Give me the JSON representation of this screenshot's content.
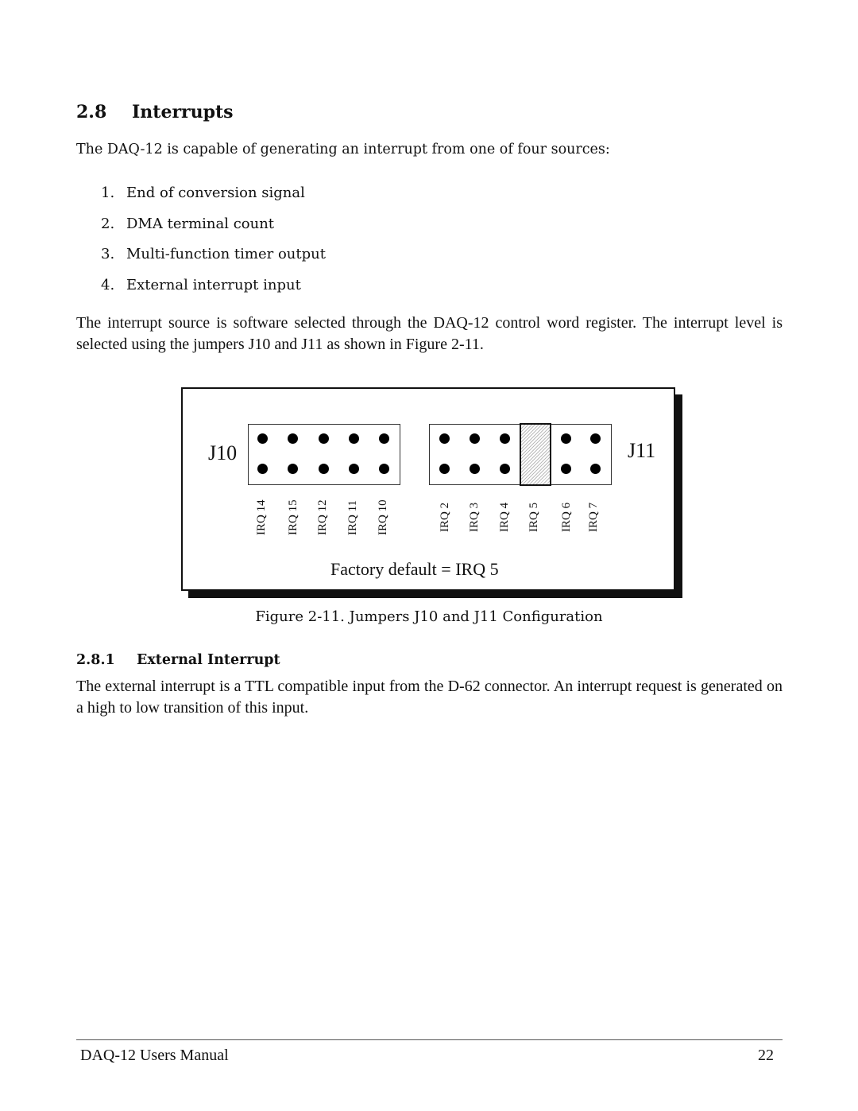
{
  "section": {
    "number": "2.8",
    "title": "Interrupts"
  },
  "intro": "The DAQ-12 is capable of generating an interrupt from one of four sources:",
  "sources": [
    {
      "num": "1.",
      "text": "End of conversion signal"
    },
    {
      "num": "2.",
      "text": "DMA terminal count"
    },
    {
      "num": "3.",
      "text": "Multi-function timer output"
    },
    {
      "num": "4.",
      "text": "External interrupt input"
    }
  ],
  "selection_paragraph": "The interrupt source is software selected through the DAQ-12 control word register. The interrupt level is selected using the jumpers J10 and J11 as shown in Figure 2-11.",
  "figure": {
    "j10_label": "J10",
    "j11_label": "J11",
    "j10_irqs": [
      "IRQ 14",
      "IRQ 15",
      "IRQ 12",
      "IRQ 11",
      "IRQ 10"
    ],
    "j11_irqs": [
      "IRQ 2",
      "IRQ 3",
      "IRQ 4",
      "IRQ 5",
      "IRQ 6",
      "IRQ 7"
    ],
    "jumpered_irq": "IRQ 5",
    "factory_default": "Factory default = IRQ 5",
    "caption": "Figure 2-11. Jumpers J10 and J11 Configuration"
  },
  "subsection": {
    "number": "2.8.1",
    "title": "External Interrupt"
  },
  "external_paragraph": "The external interrupt is a TTL compatible input from the D-62 connector. An interrupt request is generated on a high to low transition of this input.",
  "footer": {
    "title": "DAQ-12 Users Manual",
    "page": "22"
  }
}
